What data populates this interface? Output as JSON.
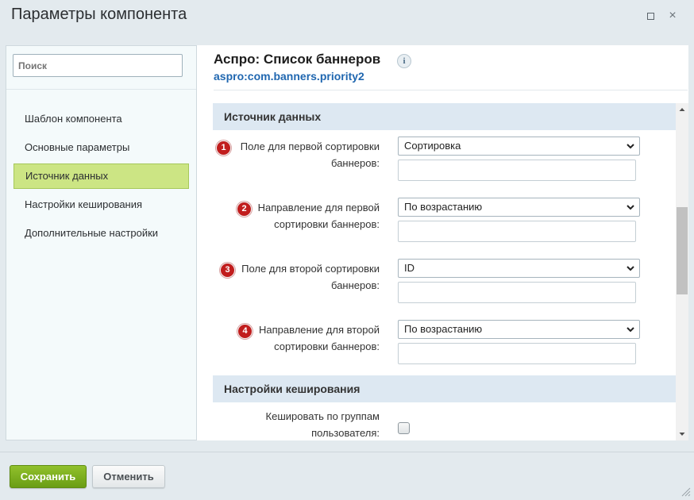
{
  "window": {
    "title": "Параметры компонента",
    "maximize_icon": "maximize-icon",
    "close_glyph": "×"
  },
  "sidebar": {
    "search_placeholder": "Поиск",
    "items": [
      {
        "label": "Шаблон компонента",
        "active": false
      },
      {
        "label": "Основные параметры",
        "active": false
      },
      {
        "label": "Источник данных",
        "active": true
      },
      {
        "label": "Настройки кеширования",
        "active": false
      },
      {
        "label": "Дополнительные настройки",
        "active": false
      }
    ]
  },
  "component": {
    "title": "Аспро: Список баннеров",
    "info_glyph": "i",
    "code": "aspro:com.banners.priority2"
  },
  "sections": {
    "data_source": {
      "title": "Источник данных",
      "fields": [
        {
          "badge": "1",
          "label_line1": "Поле для первой сортировки",
          "label_line2": "баннеров:",
          "value": "Сортировка",
          "extra_value": ""
        },
        {
          "badge": "2",
          "label_line1": "Направление для первой",
          "label_line2": "сортировки баннеров:",
          "value": "По возрастанию",
          "extra_value": ""
        },
        {
          "badge": "3",
          "label_line1": "Поле для второй сортировки",
          "label_line2": "баннеров:",
          "value": "ID",
          "extra_value": ""
        },
        {
          "badge": "4",
          "label_line1": "Направление для второй",
          "label_line2": "сортировки баннеров:",
          "value": "По возрастанию",
          "extra_value": ""
        }
      ]
    },
    "caching": {
      "title": "Настройки кеширования",
      "fields": [
        {
          "label_line1": "Кешировать по группам",
          "label_line2": "пользователя:",
          "checked": false
        }
      ]
    }
  },
  "footer": {
    "save_label": "Сохранить",
    "cancel_label": "Отменить"
  },
  "colors": {
    "save_button": "#7aad1d",
    "active_nav": "#cce584",
    "badge": "#c11d1d",
    "section_header": "#dde8f2",
    "code_link": "#2067b0"
  }
}
